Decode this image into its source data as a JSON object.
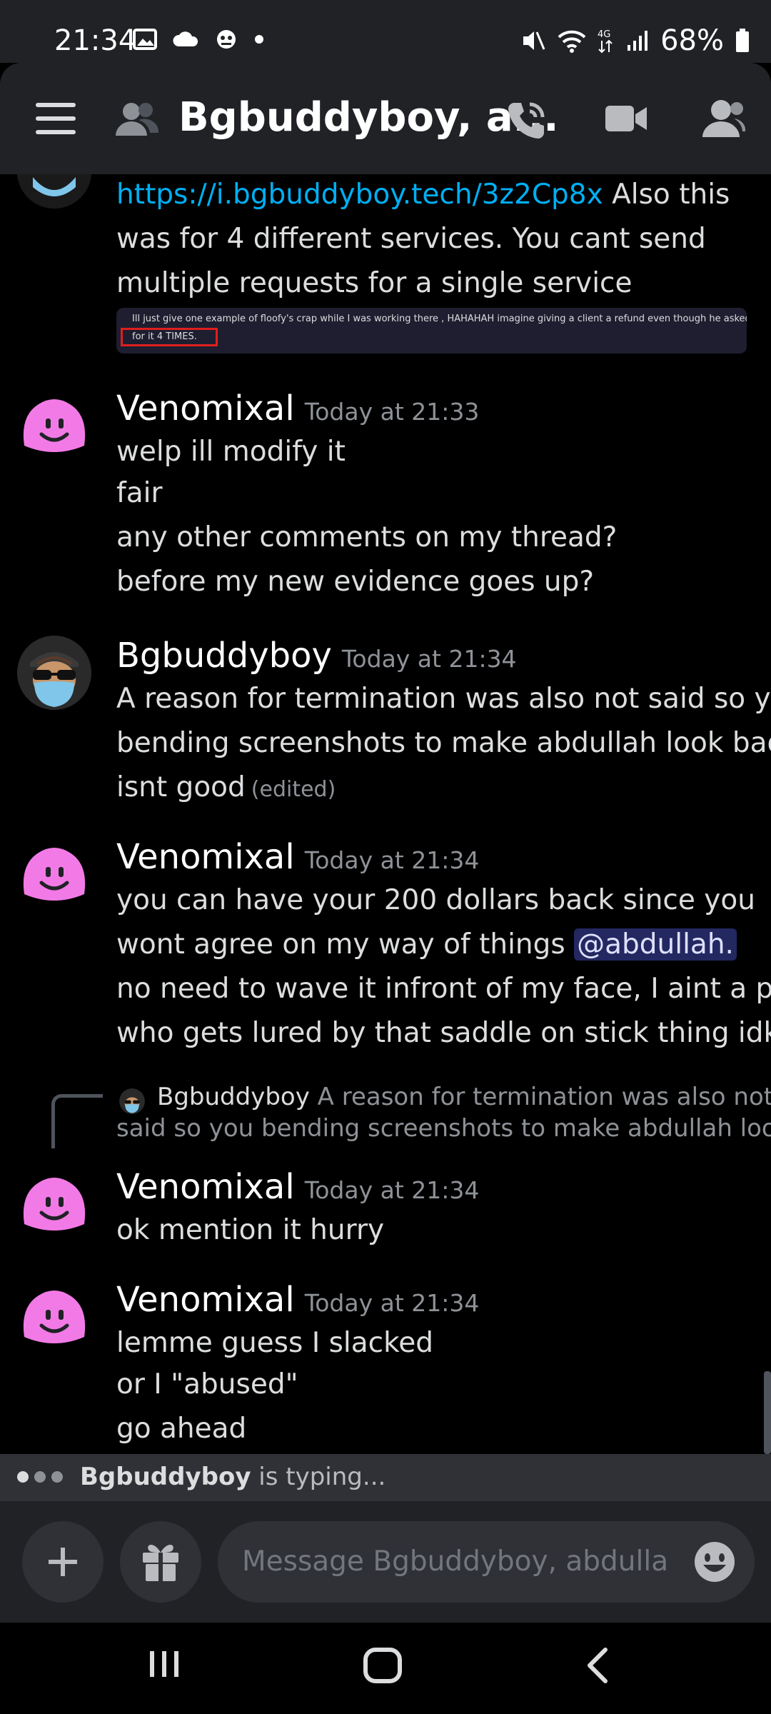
{
  "status_bar": {
    "time": "21:34",
    "battery": "68%",
    "network": "4G"
  },
  "header": {
    "title": "Bgbuddyboy, a..."
  },
  "colors": {
    "background": "#000000",
    "header": "#202225",
    "link": "#00aff4",
    "mention_bg": "#3d4279",
    "venomixal_avatar": "#f27ae6"
  },
  "messages": {
    "m0": {
      "link": "https://i.bgbuddyboy.tech/3z2Cp8x",
      "line1_rest": " Also this",
      "line2": "was for 4 different services. You cant send",
      "line3": "multiple requests for a single service",
      "embed_line1": "Ill just give one example of floofy's crap while I was working there , HAHAHAH imagine giving a client a refund even though he asked",
      "embed_line2": "for it 4 TIMES."
    },
    "g1": {
      "author": "Venomixal",
      "timestamp": "Today at 21:33",
      "lines": [
        "welp ill modify it",
        "fair",
        "any other comments on my thread?",
        "before my new evidence goes up?"
      ]
    },
    "g2": {
      "author": "Bgbuddyboy",
      "timestamp": "Today at 21:34",
      "lines": [
        "A reason for termination was also not said so you",
        "bending screenshots to make abdullah look bad",
        "isnt good"
      ],
      "edited": "(edited)"
    },
    "g3": {
      "author": "Venomixal",
      "timestamp": "Today at 21:34",
      "line1": "you can have your 200 dollars back since you",
      "line2": "wont agree on my way of things ",
      "mention": "@abdullah.",
      "line3": "no need to wave it infront of my face, I aint a pig",
      "line4": "who gets lured by that saddle on stick thing idk"
    },
    "reply": {
      "author": "Bgbuddyboy",
      "text": "A reason for termination was also not",
      "text2": "said so you bending screenshots to make abdullah look"
    },
    "g4": {
      "author": "Venomixal",
      "timestamp": "Today at 21:34",
      "lines": [
        "ok mention it hurry"
      ]
    },
    "g5": {
      "author": "Venomixal",
      "timestamp": "Today at 21:34",
      "lines": [
        "lemme guess I slacked",
        "or I \"abused\"",
        "go ahead"
      ]
    }
  },
  "typing": {
    "name": "Bgbuddyboy",
    "suffix": " is typing..."
  },
  "composer": {
    "placeholder": "Message Bgbuddyboy, abdullah."
  }
}
